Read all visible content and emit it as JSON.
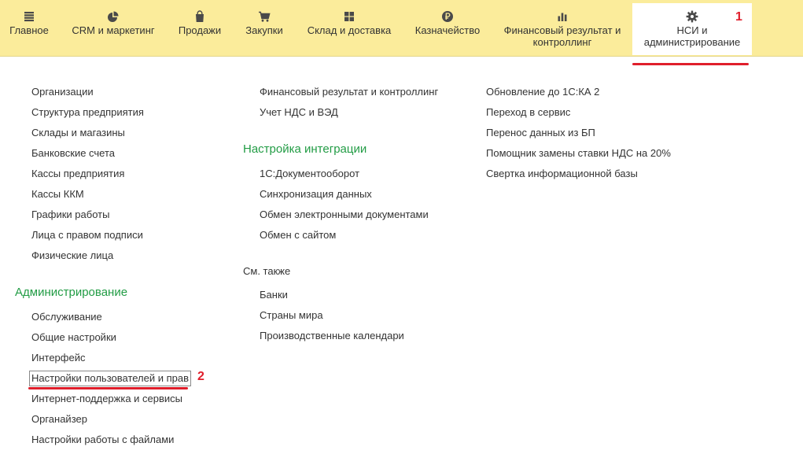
{
  "sections": [
    {
      "label": "Главное",
      "icon": "menu-lines-icon"
    },
    {
      "label": "CRM и маркетинг",
      "icon": "pie-chart-icon"
    },
    {
      "label": "Продажи",
      "icon": "shopping-bag-icon"
    },
    {
      "label": "Закупки",
      "icon": "shopping-cart-icon"
    },
    {
      "label": "Склад и доставка",
      "icon": "warehouse-grid-icon"
    },
    {
      "label": "Казначейство",
      "icon": "ruble-coin-icon"
    },
    {
      "label": "Финансовый результат и\nконтроллинг",
      "icon": "bar-chart-icon"
    },
    {
      "label": "НСИ и\nадминистрирование",
      "icon": "gear-icon",
      "active": true
    }
  ],
  "markers": {
    "one": "1",
    "two": "2",
    "color": "#e01e2b"
  },
  "col1": {
    "items": [
      "Организации",
      "Структура предприятия",
      "Склады и магазины",
      "Банковские счета",
      "Кассы предприятия",
      "Кассы ККМ",
      "Графики работы",
      "Лица с правом подписи",
      "Физические лица"
    ],
    "admin_title": "Администрирование",
    "admin_items": [
      "Обслуживание",
      "Общие настройки",
      "Интерфейс",
      "Настройки пользователей и прав",
      "Интернет-поддержка и сервисы",
      "Органайзер",
      "Настройки работы с файлами"
    ]
  },
  "col2": {
    "items": [
      "Финансовый результат и контроллинг",
      "Учет НДС и ВЭД"
    ],
    "integration_title": "Настройка интеграции",
    "integration_items": [
      "1С:Документооборот",
      "Синхронизация данных",
      "Обмен электронными документами",
      "Обмен с сайтом"
    ],
    "see_also_title": "См. также",
    "see_also_items": [
      "Банки",
      "Страны мира",
      "Производственные календари"
    ]
  },
  "col3": {
    "items": [
      "Обновление до 1С:КА 2",
      "Переход в сервис",
      "Перенос данных из БП",
      "Помощник замены ставки НДС на 20%",
      "Свертка информационной базы"
    ]
  },
  "colors": {
    "topbar": "#fbec9b",
    "group_title": "#229c45",
    "text": "#333333"
  }
}
